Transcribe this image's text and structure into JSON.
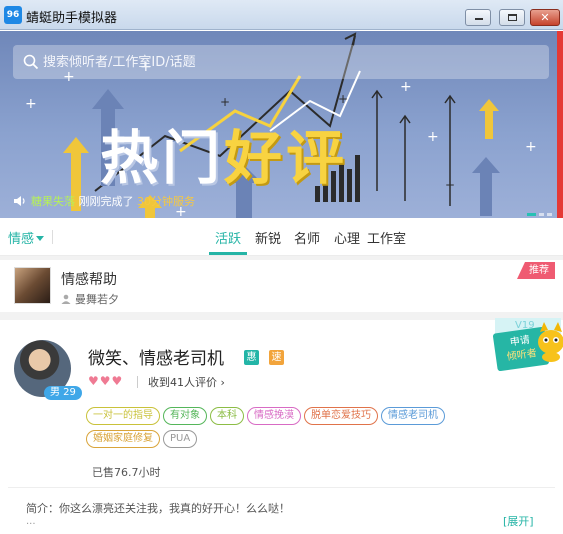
{
  "window": {
    "title": "蜻蜓助手模拟器",
    "logo_text": "96"
  },
  "search": {
    "placeholder": "搜索倾听者/工作室ID/话题"
  },
  "banner": {
    "headline_white": "热门",
    "headline_yellow": "好评",
    "ticker": {
      "user": "糖果失落",
      "prefix": "刚刚完成了",
      "count": "30分钟服务"
    }
  },
  "tabs": {
    "category": "情感",
    "items": [
      "活跃",
      "新锐",
      "名师",
      "心理",
      "工作室"
    ],
    "active_index": 0
  },
  "promo": {
    "title": "情感帮助",
    "author": "曼舞若夕",
    "tag": "推荐"
  },
  "listener": {
    "name": "微笑、情感老司机",
    "badge_hui": "惠",
    "badge_su": "速",
    "gender_age": "男 29",
    "hearts": "♥♥♥",
    "reviews": "收到41人评价",
    "apply_ribbon": "V19",
    "apply_line1": "申请",
    "apply_line2": "倾听者",
    "tags": [
      {
        "text": "一对一的指导",
        "color": "#c9c23a"
      },
      {
        "text": "有对象",
        "color": "#55b65a"
      },
      {
        "text": "本科",
        "color": "#8cbd45"
      },
      {
        "text": "情感挽漠",
        "color": "#d86bc4"
      },
      {
        "text": "脱单恋爱技巧",
        "color": "#e0734a"
      },
      {
        "text": "情感老司机",
        "color": "#5b9bd8"
      },
      {
        "text": "婚姻家庭修复",
        "color": "#d9a43a"
      },
      {
        "text": "PUA",
        "color": "#999999"
      }
    ],
    "sold": "已售76.7小时",
    "intro": "简介：你这么漂亮还关注我，我真的好开心！么么哒！",
    "intro_more": "...",
    "expand": "[展开]"
  },
  "colors": {
    "accent": "#25b4a6",
    "banner_blue": "#7f97c8",
    "recommend": "#ef5b72"
  }
}
